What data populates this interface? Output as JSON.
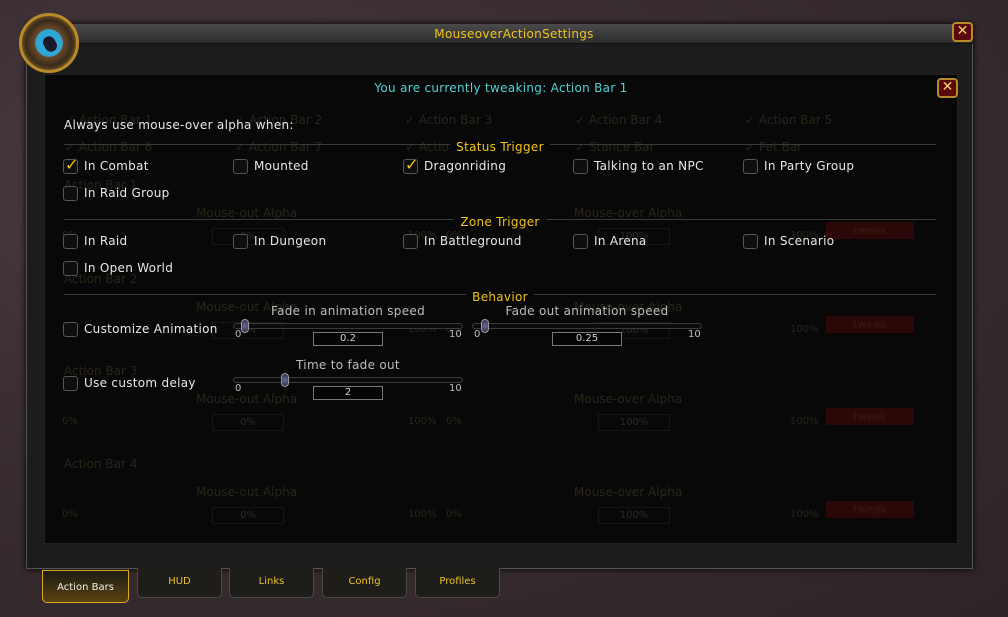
{
  "window": {
    "title": "MouseoverActionSettings",
    "close_icon": "close-x-icon"
  },
  "panel": {
    "header": "You are currently tweaking: Action Bar 1",
    "close_icon": "close-x-icon"
  },
  "background_ghost": {
    "bar_checks": [
      "Action Bar 1",
      "Action Bar 2",
      "Action Bar 3",
      "Action Bar 4",
      "Action Bar 5",
      "Action Bar 6",
      "Action Bar 7",
      "Action Bar 8",
      "Stance Bar",
      "Pet Bar"
    ],
    "sections": [
      "Action Bar 1",
      "Action Bar 2",
      "Action Bar 3",
      "Action Bar 4"
    ],
    "mouse_out_label": "Mouse-out Alpha",
    "mouse_over_label": "Mouse-over Alpha",
    "tweak_label": "tweak",
    "zero": "0%",
    "hundred": "100%"
  },
  "intro": "Always use mouse-over alpha when:",
  "status_trigger": {
    "title": "Status Trigger",
    "items": [
      {
        "label": "In Combat",
        "checked": true
      },
      {
        "label": "Mounted",
        "checked": false
      },
      {
        "label": "Dragonriding",
        "checked": true
      },
      {
        "label": "Talking to an NPC",
        "checked": false
      },
      {
        "label": "In Party Group",
        "checked": false
      },
      {
        "label": "In Raid Group",
        "checked": false
      }
    ]
  },
  "zone_trigger": {
    "title": "Zone Trigger",
    "items": [
      {
        "label": "In Raid",
        "checked": false
      },
      {
        "label": "In Dungeon",
        "checked": false
      },
      {
        "label": "In Battleground",
        "checked": false
      },
      {
        "label": "In Arena",
        "checked": false
      },
      {
        "label": "In Scenario",
        "checked": false
      },
      {
        "label": "In Open World",
        "checked": false
      }
    ]
  },
  "behavior": {
    "title": "Behavior",
    "customize_animation": {
      "label": "Customize Animation",
      "checked": false
    },
    "use_custom_delay": {
      "label": "Use custom delay",
      "checked": false
    },
    "fade_in": {
      "label": "Fade in animation speed",
      "min": "0",
      "max": "10",
      "value": "0.2"
    },
    "fade_out": {
      "label": "Fade out animation speed",
      "min": "0",
      "max": "10",
      "value": "0.25"
    },
    "fade_time": {
      "label": "Time to fade out",
      "min": "0",
      "max": "10",
      "value": "2"
    }
  },
  "tabs": [
    {
      "label": "Action Bars",
      "selected": true
    },
    {
      "label": "HUD",
      "selected": false
    },
    {
      "label": "Links",
      "selected": false
    },
    {
      "label": "Config",
      "selected": false
    },
    {
      "label": "Profiles",
      "selected": false
    }
  ]
}
